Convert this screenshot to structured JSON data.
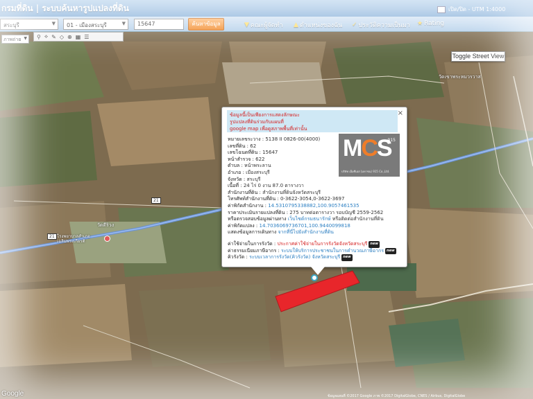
{
  "header": {
    "title": "กรมที่ดิน | ระบบค้นหารูปแปลงที่ดิน",
    "utm_label": "เปิด/ปิด - UTM 1:4000"
  },
  "search": {
    "province": "สระบุรี",
    "district": "01 - เมืองสระบุรี",
    "parcel_no": "15647",
    "search_button": "ค้นหาข้อมูล"
  },
  "links": [
    {
      "icon": "team-icon",
      "label": "คณะผู้จัดทำ"
    },
    {
      "icon": "location-icon",
      "label": "ตำแหน่งของฉัน"
    },
    {
      "icon": "history-icon",
      "label": "ประวัติความเป็นมา"
    },
    {
      "icon": "star-icon",
      "label": "Rating"
    }
  ],
  "toolbar": {
    "layer_select": "ภาพถ่าย",
    "icons": [
      "map-pin-icon",
      "route-icon",
      "measure-icon",
      "polygon-icon",
      "zoom-icon"
    ]
  },
  "map": {
    "street_view_button": "Toggle Street View",
    "labels": {
      "temple_top": "วัดเขาพระหมวรวาส",
      "temple_left": "วัดดีริวง",
      "hospital": "โรงพยาบาลสำเภอ เฉลิมพระเกียรติ",
      "road_shield": "21"
    },
    "google_logo": "Google",
    "copyright": "ข้อมูลแผนที่ ©2017 Google ภาพ ©2017 DigitalGlobe, CNES / Airbus, DigitalGlobe"
  },
  "infowindow": {
    "close": "×",
    "notice": [
      "ข้อมูลนี้เป็นเพียงการแสดงลักษณะ",
      "รูปแปลงที่ดินร่วมกับแผนที่",
      "google map เพื่อดูสภาพพื้นที่เท่านั้น"
    ],
    "fields": [
      {
        "label": "หมายเลขระวาง",
        "value": "5138 II 0826-00(4000)"
      },
      {
        "label": "เลขที่ดิน",
        "value": "62"
      },
      {
        "label": "เลขโฉนดที่ดิน",
        "value": "15647"
      },
      {
        "label": "หน้าสำรวจ",
        "value": "622"
      },
      {
        "label": "ตำบล",
        "value": "หน้าพระลาน"
      },
      {
        "label": "อำเภอ",
        "value": "เมืองสระบุรี"
      },
      {
        "label": "จังหวัด",
        "value": "สระบุรี"
      },
      {
        "label": "เนื้อที่",
        "value": "24 ไร่ 0 งาน 87.0 ตารางวา"
      },
      {
        "label": "สำนักงานที่ดิน",
        "value": "สำนักงานที่ดินจังหวัดสระบุรี"
      },
      {
        "label": "โทรศัพท์สำนักงานที่ดิน",
        "value": "0-3622-3054,0-3622-3697"
      },
      {
        "label": "ค่าพิกัดสำนักงาน",
        "value": "14.5310795338882,100.9057461535"
      },
      {
        "label": "ราคาประเมินรายแปลงที่ดิน",
        "value": "275 บาทต่อตารางวา รอบบัญชี 2559-2562"
      },
      {
        "label": "หรือตรวจสอบข้อมูลผ่านทาง",
        "value": "เว็บไซต์กรมธนารักษ์",
        "tail": "หรือติดต่อสำนักงานที่ดิน"
      },
      {
        "label": "ค่าพิกัดแปลง",
        "value": "14.7036069736701,100.9440099818"
      },
      {
        "label": "แสดงข้อมูลการเดินทาง",
        "value": "จากที่นี่ไปยังสำนักงานที่ดิน"
      }
    ],
    "links": [
      {
        "label": "ค่าใช้จ่ายในการรังวัด",
        "value": "ประกาศค่าใช้จ่ายในการรังวัดจังหวัดสระบุรี"
      },
      {
        "label": "ค่าธรรมเนียมภาษีอากร",
        "value": "ระบบให้บริการประชาชนในการคำนวณภาษีอากร"
      },
      {
        "label": "คิวรังวัด",
        "value": "ระบบเวลาการรังวัด(คิวรังวัด) จังหวัดสระบุรี"
      }
    ],
    "new_badge": "new",
    "logo": {
      "text_m": "M",
      "text_c": "C",
      "text_s": "S",
      "tag": "915",
      "subtitle": "บริษัท เอ็มซีเอส (มหาชน) 915 Co.,Ltd."
    }
  },
  "colors": {
    "parcel": "#e8262b",
    "link": "#2c7fc2",
    "warning": "#d52020",
    "header": "#8fb6df"
  }
}
